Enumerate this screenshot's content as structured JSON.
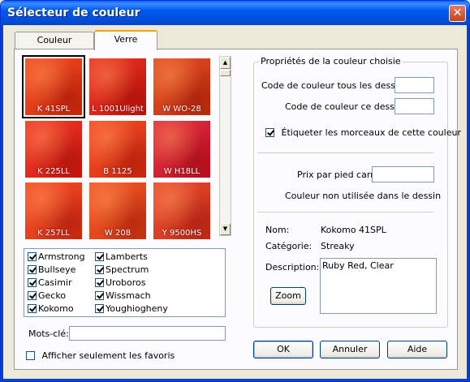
{
  "window": {
    "title": "Sélecteur de couleur"
  },
  "tabs": [
    {
      "label": "Couleur texturée",
      "active": false
    },
    {
      "label": "Verre",
      "active": true
    }
  ],
  "swatches": [
    {
      "code": "K 41SPL",
      "selected": true,
      "color": "#f0340a"
    },
    {
      "code": "L 1001Ulight",
      "selected": false,
      "color": "#e81a0c"
    },
    {
      "code": "W WO-28",
      "selected": false,
      "color": "#e0380c"
    },
    {
      "code": "K 225LL",
      "selected": false,
      "color": "#ef1f10"
    },
    {
      "code": "B 1125",
      "selected": false,
      "color": "#f5350f"
    },
    {
      "code": "W H18LL",
      "selected": false,
      "color": "#e0142a"
    },
    {
      "code": "K 257LL",
      "selected": false,
      "color": "#f53812"
    },
    {
      "code": "W 208",
      "selected": false,
      "color": "#f2420f"
    },
    {
      "code": "Y 9500HS",
      "selected": false,
      "color": "#e8361a"
    }
  ],
  "manufacturers": {
    "col1": [
      {
        "label": "Armstrong",
        "checked": true
      },
      {
        "label": "Bullseye",
        "checked": true
      },
      {
        "label": "Casimir",
        "checked": true
      },
      {
        "label": "Gecko",
        "checked": true
      },
      {
        "label": "Kokomo",
        "checked": true
      }
    ],
    "col2": [
      {
        "label": "Lamberts",
        "checked": true
      },
      {
        "label": "Spectrum",
        "checked": true
      },
      {
        "label": "Uroboros",
        "checked": true
      },
      {
        "label": "Wissmach",
        "checked": true
      },
      {
        "label": "Youghiogheny",
        "checked": true
      }
    ]
  },
  "keywords": {
    "label": "Mots-clé:",
    "value": ""
  },
  "favorites": {
    "label": "Afficher seulement les favoris",
    "checked": false
  },
  "properties": {
    "group_title": "Propriétés de la couleur choisie",
    "code_all_label": "Code de couleur tous les dessins:",
    "code_all_value": "",
    "code_this_label": "Code de couleur ce dessin:",
    "code_this_value": "",
    "label_pieces": "Étiqueter les morceaux de cette couleur",
    "label_pieces_checked": true,
    "price_label": "Prix par pied carré:",
    "price_value": "",
    "unused_note": "Couleur non utilisée dans le dessin",
    "name_label": "Nom:",
    "name_value": "Kokomo 41SPL",
    "category_label": "Catégorie:",
    "category_value": "Streaky",
    "description_label": "Description:",
    "description_value": "Ruby Red, Clear",
    "zoom_label": "Zoom"
  },
  "buttons": {
    "ok": "OK",
    "cancel": "Annuler",
    "help": "Aide"
  }
}
